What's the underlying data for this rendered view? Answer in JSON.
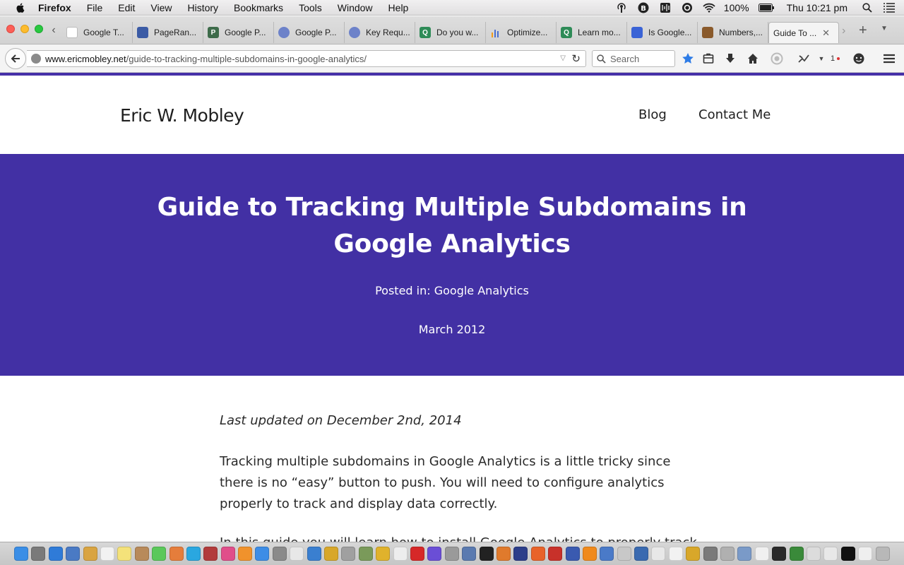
{
  "menubar": {
    "app_name": "Firefox",
    "menus": [
      "File",
      "Edit",
      "View",
      "History",
      "Bookmarks",
      "Tools",
      "Window",
      "Help"
    ],
    "status_icons": [
      "airdrop-icon",
      "b-icon",
      "sound-icon",
      "o-icon",
      "wifi-icon"
    ],
    "battery": "100%",
    "clock": "Thu 10:21 pm"
  },
  "tabs": [
    {
      "title": "Google T...",
      "favicon": "blank-page-icon",
      "color": "#ffffff"
    },
    {
      "title": "PageRan...",
      "favicon": "pagerank-icon",
      "color": "#3b5ba5"
    },
    {
      "title": "Google P...",
      "favicon": "pr-icon",
      "color": "#3d6b4a"
    },
    {
      "title": "Google P...",
      "favicon": "globe-icon",
      "color": "#6d82c9"
    },
    {
      "title": "Key Requ...",
      "favicon": "globe-icon",
      "color": "#6d82c9"
    },
    {
      "title": "Do you w...",
      "favicon": "quora-icon",
      "color": "#2e8b57"
    },
    {
      "title": "Optimize...",
      "favicon": "chart-icon",
      "color": "#4a6fd1"
    },
    {
      "title": "Learn mo...",
      "favicon": "quora-icon",
      "color": "#2e8b57"
    },
    {
      "title": "Is Google...",
      "favicon": "blue-doc-icon",
      "color": "#3a63d6"
    },
    {
      "title": "Numbers,...",
      "favicon": "image-icon",
      "color": "#8a5a2b"
    }
  ],
  "active_tab": {
    "title": "Guide To ...",
    "close": "✕"
  },
  "navbar": {
    "url_domain": "www.ericmobley.net",
    "url_path": "/guide-to-tracking-multiple-subdomains-in-google-analytics/",
    "search_placeholder": "Search",
    "addon_count": "1"
  },
  "site": {
    "name": "Eric W. Mobley",
    "nav": {
      "blog": "Blog",
      "contact": "Contact Me"
    }
  },
  "hero": {
    "title": "Guide to Tracking Multiple Subdomains in Google Analytics",
    "posted_in": "Posted in: Google Analytics",
    "date": "March 2012",
    "color": "#4230a4"
  },
  "article": {
    "last_updated": "Last updated on December 2nd, 2014",
    "paragraph1": "Tracking multiple subdomains in Google Analytics is a little tricky since there is no “easy” button to push. You will need to configure analytics properly to track and display data correctly.",
    "paragraph2": "In this guide you will learn how to install Google Analytics to properly track"
  },
  "dock_icons": [
    {
      "name": "finder-icon",
      "color": "#3a8ee6"
    },
    {
      "name": "launchpad-icon",
      "color": "#7a7a7a"
    },
    {
      "name": "safari-icon",
      "color": "#2f7bd8"
    },
    {
      "name": "preview-icon",
      "color": "#4a7ac4"
    },
    {
      "name": "notes-icon",
      "color": "#d9a441"
    },
    {
      "name": "calendar-icon",
      "color": "#f2f2f2"
    },
    {
      "name": "stickies-icon",
      "color": "#f4e27a"
    },
    {
      "name": "contacts-icon",
      "color": "#b88a5a"
    },
    {
      "name": "messages-icon",
      "color": "#5ac85a"
    },
    {
      "name": "photos-icon",
      "color": "#e57d3b"
    },
    {
      "name": "skype-icon",
      "color": "#2aa7e0"
    },
    {
      "name": "photo-booth-icon",
      "color": "#b23b3b"
    },
    {
      "name": "itunes-icon",
      "color": "#e04e8a"
    },
    {
      "name": "ibooks-icon",
      "color": "#f0922c"
    },
    {
      "name": "app-store-icon",
      "color": "#3d8de6"
    },
    {
      "name": "system-prefs-icon",
      "color": "#8a8a8a"
    },
    {
      "name": "textedit-icon",
      "color": "#e8e8e8"
    },
    {
      "name": "xcode-icon",
      "color": "#3a7fd0"
    },
    {
      "name": "wordpress-icon",
      "color": "#d8a72a"
    },
    {
      "name": "utility-icon",
      "color": "#a0a0a0"
    },
    {
      "name": "image-capture-icon",
      "color": "#7a9a5a"
    },
    {
      "name": "chrome-icon",
      "color": "#e0b22c"
    },
    {
      "name": "document-icon",
      "color": "#ededed"
    },
    {
      "name": "opera-icon",
      "color": "#d62828"
    },
    {
      "name": "imovie-icon",
      "color": "#6a4ed6"
    },
    {
      "name": "archive-icon",
      "color": "#9a9a9a"
    },
    {
      "name": "screenshot-icon",
      "color": "#5a7ab0"
    },
    {
      "name": "terminal-icon",
      "color": "#222222"
    },
    {
      "name": "coda-icon",
      "color": "#e07a2c"
    },
    {
      "name": "bbedit-icon",
      "color": "#2c3e8a"
    },
    {
      "name": "firefox-icon",
      "color": "#e8632a"
    },
    {
      "name": "filezilla-icon",
      "color": "#c8312a"
    },
    {
      "name": "camino-icon",
      "color": "#3a5ab0"
    },
    {
      "name": "vlc-icon",
      "color": "#f08a1c"
    },
    {
      "name": "display-icon",
      "color": "#4a7ac8"
    },
    {
      "name": "help-icon",
      "color": "#c8c8c8"
    },
    {
      "name": "virtualbox-icon",
      "color": "#3a6ab0"
    },
    {
      "name": "script-icon",
      "color": "#e8e8e8"
    },
    {
      "name": "page-icon",
      "color": "#f2f2f2"
    },
    {
      "name": "wordpress-icon",
      "color": "#d8a72a"
    },
    {
      "name": "printer-icon",
      "color": "#7a7a7a"
    },
    {
      "name": "usb-icon",
      "color": "#b0b0b0"
    },
    {
      "name": "folder-icon",
      "color": "#7a9ac8"
    },
    {
      "name": "window-icon",
      "color": "#f0f0f0"
    },
    {
      "name": "activity-icon",
      "color": "#2a2a2a"
    },
    {
      "name": "green-app-icon",
      "color": "#3a8a3a"
    },
    {
      "name": "window-icon",
      "color": "#dcdcdc"
    },
    {
      "name": "window-icon",
      "color": "#e8e8e8"
    },
    {
      "name": "black-window-icon",
      "color": "#111111"
    },
    {
      "name": "window-icon",
      "color": "#efefef"
    },
    {
      "name": "trash-icon",
      "color": "#b8b8b8"
    }
  ]
}
